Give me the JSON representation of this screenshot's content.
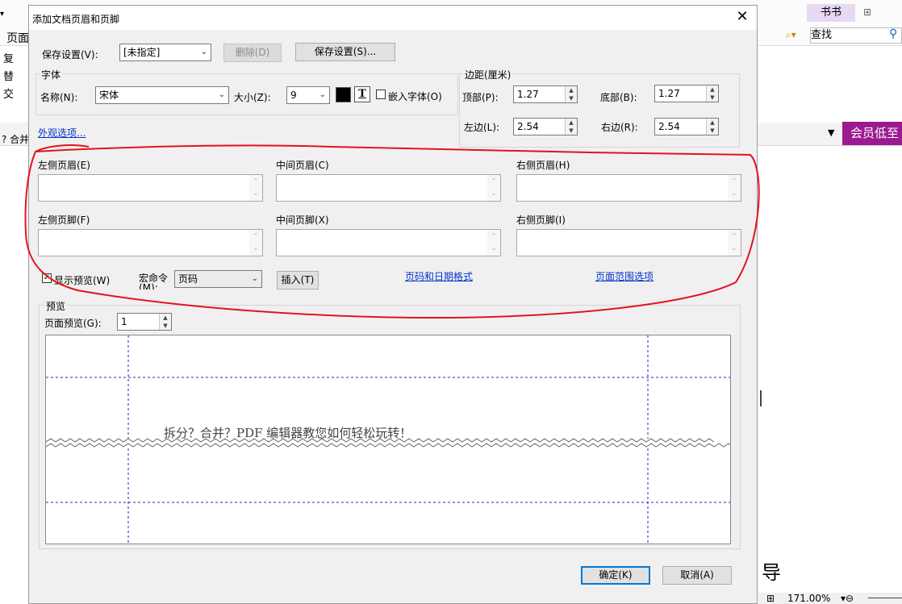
{
  "background": {
    "menu_label": "页面",
    "left_items": [
      "复",
      "替",
      "交"
    ],
    "row_label": "? 合并",
    "book_tab": "书书",
    "search_placeholder": "查找",
    "member_button": "会员低至",
    "zoom": "171.00%",
    "bottom_char": "导"
  },
  "dialog": {
    "title": "添加文档页眉和页脚",
    "close_glyph": "✕",
    "save_settings_label": "保存设置(V):",
    "save_settings_value": "[未指定]",
    "delete_button": "删除(D)",
    "save_button": "保存设置(S)...",
    "font": {
      "group_title": "字体",
      "name_label": "名称(N):",
      "name_value": "宋体",
      "size_label": "大小(Z):",
      "size_value": "9",
      "color": "#000000",
      "underline_glyph": "T",
      "embed_label": "嵌入字体(O)",
      "embed_checked": false
    },
    "appearance_link": "外观选项...",
    "margins": {
      "group_title": "边距(厘米)",
      "top_label": "顶部(P):",
      "top_value": "1.27",
      "bottom_label": "底部(B):",
      "bottom_value": "1.27",
      "left_label": "左边(L):",
      "left_value": "2.54",
      "right_label": "右边(R):",
      "right_value": "2.54"
    },
    "fields": {
      "left_header_label": "左侧页眉(E)",
      "center_header_label": "中间页眉(C)",
      "right_header_label": "右侧页眉(H)",
      "left_footer_label": "左侧页脚(F)",
      "center_footer_label": "中间页脚(X)",
      "right_footer_label": "右侧页脚(I)"
    },
    "show_preview_label": "显示预览(W)",
    "show_preview_checked": true,
    "macro_label": "宏命令(M):",
    "macro_value": "页码",
    "insert_button": "插入(T)",
    "page_date_link": "页码和日期格式",
    "page_range_link": "页面范围选项",
    "preview": {
      "group_title": "预览",
      "page_label": "页面预览(G):",
      "page_value": "1",
      "sample_text": "拆分？合并？PDF 编辑器教您如何轻松玩转！"
    },
    "ok_button": "确定(K)",
    "cancel_button": "取消(A)",
    "annotation_color": "#e0141e"
  }
}
